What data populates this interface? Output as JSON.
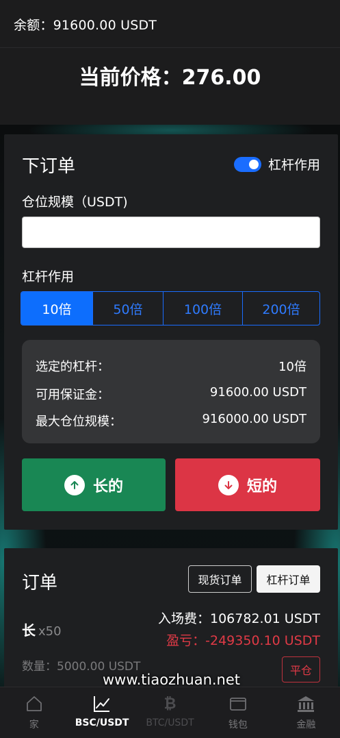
{
  "header": {
    "balance_label": "余额：",
    "balance_value": "91600.00 USDT",
    "price_label": "当前价格：",
    "price_value": "276.00"
  },
  "order_form": {
    "title": "下订单",
    "leverage_toggle_label": "杠杆作用",
    "leverage_toggle_on": true,
    "position_size_label": "仓位规模（USDT)",
    "position_size_value": "",
    "leverage_label": "杠杆作用",
    "leverage_options": [
      "10倍",
      "50倍",
      "100倍",
      "200倍"
    ],
    "leverage_selected": "10倍",
    "summary": {
      "selected_leverage_label": "选定的杠杆：",
      "selected_leverage_value": "10倍",
      "available_margin_label": "可用保证金：",
      "available_margin_value": "91600.00 USDT",
      "max_position_label": "最大仓位规模：",
      "max_position_value": "916000.00 USDT"
    },
    "long_button": "长的",
    "short_button": "短的"
  },
  "orders": {
    "title": "订单",
    "tabs": [
      "现货订单",
      "杠杆订单"
    ],
    "active_tab": "杠杆订单",
    "items": [
      {
        "side": "长",
        "leverage": "x50",
        "entry_label": "入场费：",
        "entry_value": "106782.01 USDT",
        "pnl_label": "盈亏：",
        "pnl_value": "-249350.10 USDT",
        "qty_label": "数量：",
        "qty_value": "5000.00 USDT",
        "close_label": "平仓"
      }
    ]
  },
  "watermark": "www.tiaozhuan.net",
  "nav": {
    "items": [
      {
        "label": "家",
        "icon": "home-icon"
      },
      {
        "label": "BSC/USDT",
        "icon": "chart-line-icon"
      },
      {
        "label": "BTC/USDT",
        "icon": "bitcoin-icon"
      },
      {
        "label": "钱包",
        "icon": "wallet-icon"
      },
      {
        "label": "金融",
        "icon": "bank-icon"
      }
    ],
    "active": "BSC/USDT"
  },
  "colors": {
    "accent": "#0d6efd",
    "long": "#198754",
    "short": "#dc3545",
    "loss_text": "#e03a46"
  }
}
